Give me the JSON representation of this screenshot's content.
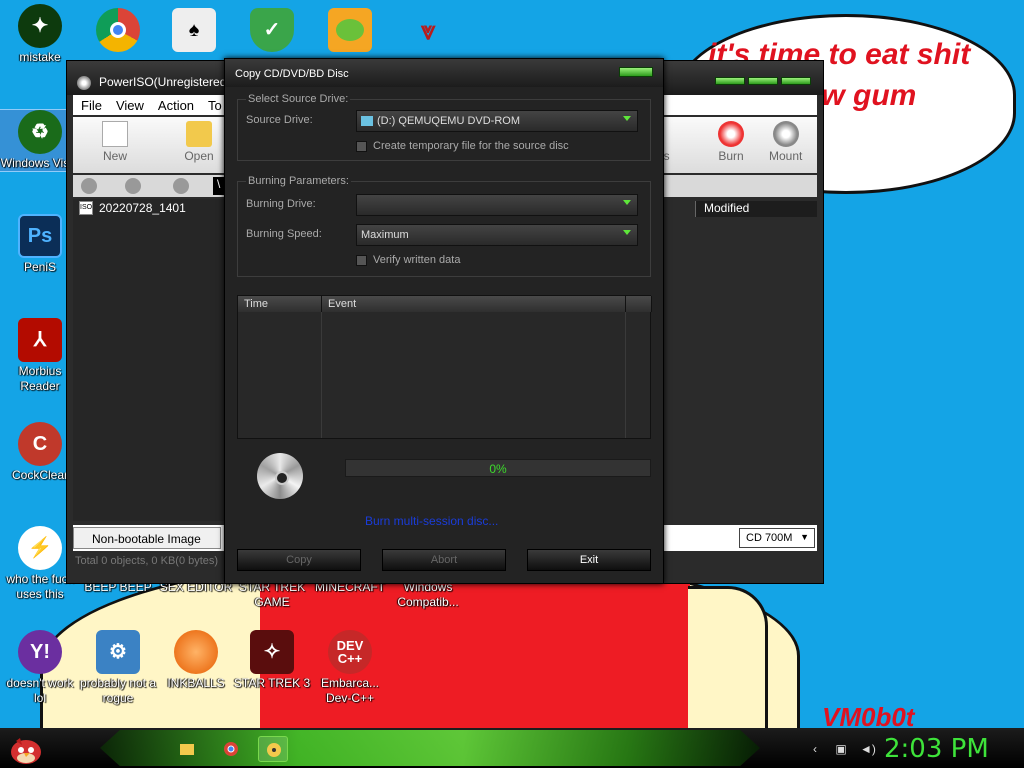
{
  "wallpaper": {
    "speech_text": "it's time to eat shit and chew gum",
    "signature": "VM0b0t"
  },
  "desktop_icons": [
    {
      "label": "mistake",
      "icon": "mistake-icon",
      "color": "#0d3a0d"
    },
    {
      "label": "Windows Vista",
      "icon": "recycle-bin-icon",
      "color": "#1a6b1a"
    },
    {
      "label": "PeniS",
      "icon": "photoshop-icon",
      "color": "#0b2e57"
    },
    {
      "label": "Morbius Reader",
      "icon": "pdf-reader-icon",
      "color": "#b30b00"
    },
    {
      "label": "CockClear",
      "icon": "ccleaner-icon",
      "color": "#c0392b"
    },
    {
      "label": "who the fuck uses this",
      "icon": "lightning-icon",
      "color": "#f05a22"
    },
    {
      "label": "doesn't work lol",
      "icon": "yahoo-messenger-icon",
      "color": "#6b2fa0"
    },
    {
      "label": "",
      "icon": "chrome-icon",
      "color": "#2f9d49"
    },
    {
      "label": "",
      "icon": "solitaire-icon",
      "color": "#eeeeee"
    },
    {
      "label": "",
      "icon": "shield-check-icon",
      "color": "#3aa54a"
    },
    {
      "label": "",
      "icon": "bad-piggies-icon",
      "color": "#f5a623"
    },
    {
      "label": "",
      "icon": "starfleet-icon",
      "color": "#b71c1c"
    },
    {
      "label": "BEEP BEEP",
      "icon": "",
      "color": ""
    },
    {
      "label": "SEX EDITOR",
      "icon": "",
      "color": ""
    },
    {
      "label": "STAR TREK GAME",
      "icon": "",
      "color": ""
    },
    {
      "label": "MINECRAFT",
      "icon": "",
      "color": ""
    },
    {
      "label": "Windows Compatib...",
      "icon": "",
      "color": ""
    },
    {
      "label": "probably not a rogue",
      "icon": "gears-icon",
      "color": "#3b82c4"
    },
    {
      "label": "INKBALLS",
      "icon": "inkball-icon",
      "color": "#e65c00"
    },
    {
      "label": "STAR TREK 3",
      "icon": "star-trek-icon",
      "color": "#5a0d0d"
    },
    {
      "label": "Embarca... Dev-C++",
      "icon": "devcpp-icon",
      "color": "#c62828"
    }
  ],
  "main_window": {
    "title": "PowerISO(Unregistered c",
    "menu": [
      "File",
      "View",
      "Action",
      "To"
    ],
    "toolbar": [
      {
        "label": "New",
        "icon": "new-file-icon"
      },
      {
        "label": "Open",
        "icon": "open-folder-icon"
      },
      {
        "label": "ress",
        "icon": "compress-icon"
      },
      {
        "label": "Burn",
        "icon": "burn-disc-icon"
      },
      {
        "label": "Mount",
        "icon": "mount-icon"
      }
    ],
    "path": "\\",
    "tree_item": "20220728_1401",
    "column_modified": "Modified",
    "image_type": "Non-bootable Image",
    "capacity": "CD 700M",
    "status": "Total 0 objects, 0 KB(0 bytes)"
  },
  "dialog": {
    "title": "Copy CD/DVD/BD Disc",
    "source_group": "Select Source Drive:",
    "source_label": "Source Drive:",
    "source_value": "(D:) QEMUQEMU DVD-ROM",
    "temp_file_label": "Create temporary file for the source disc",
    "burn_group": "Burning Parameters:",
    "burn_drive_label": "Burning Drive:",
    "burn_drive_value": "",
    "burn_speed_label": "Burning Speed:",
    "burn_speed_value": "Maximum",
    "verify_label": "Verify written data",
    "log_col_time": "Time",
    "log_col_event": "Event",
    "progress_text": "0%",
    "progress_value": 0,
    "link_text": "Burn multi-session disc...",
    "btn_copy": "Copy",
    "btn_abort": "Abort",
    "btn_exit": "Exit"
  },
  "taskbar": {
    "clock": "2:03 PM",
    "accent": "#3ee33a"
  }
}
